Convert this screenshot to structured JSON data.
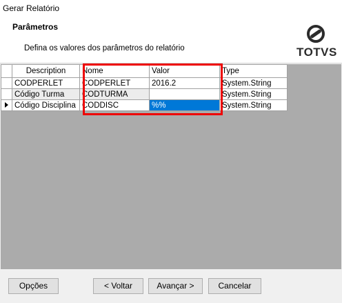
{
  "window": {
    "title": "Gerar Relatório"
  },
  "header": {
    "title": "Parâmetros",
    "subtitle": "Defina os valores dos parâmetros do relatório",
    "logo_text": "TOTVS"
  },
  "grid": {
    "columns": [
      "Description",
      "Nome",
      "Valor",
      "Type"
    ],
    "rows": [
      {
        "description": "CODPERLET",
        "nome": "CODPERLET",
        "valor": "2016.2",
        "type": "System.String"
      },
      {
        "description": "Código Turma",
        "nome": "CODTURMA",
        "valor": "",
        "type": "System.String"
      },
      {
        "description": "Código  Disciplina",
        "nome": "CODDISC",
        "valor": "%%",
        "type": "System.String"
      }
    ]
  },
  "buttons": {
    "opcoes": "Opções",
    "voltar": "< Voltar",
    "avancar": "Avançar >",
    "cancelar": "Cancelar"
  },
  "colors": {
    "selection": "#0078d7",
    "highlight_border": "#ee0000",
    "grid_background": "#ababab"
  }
}
